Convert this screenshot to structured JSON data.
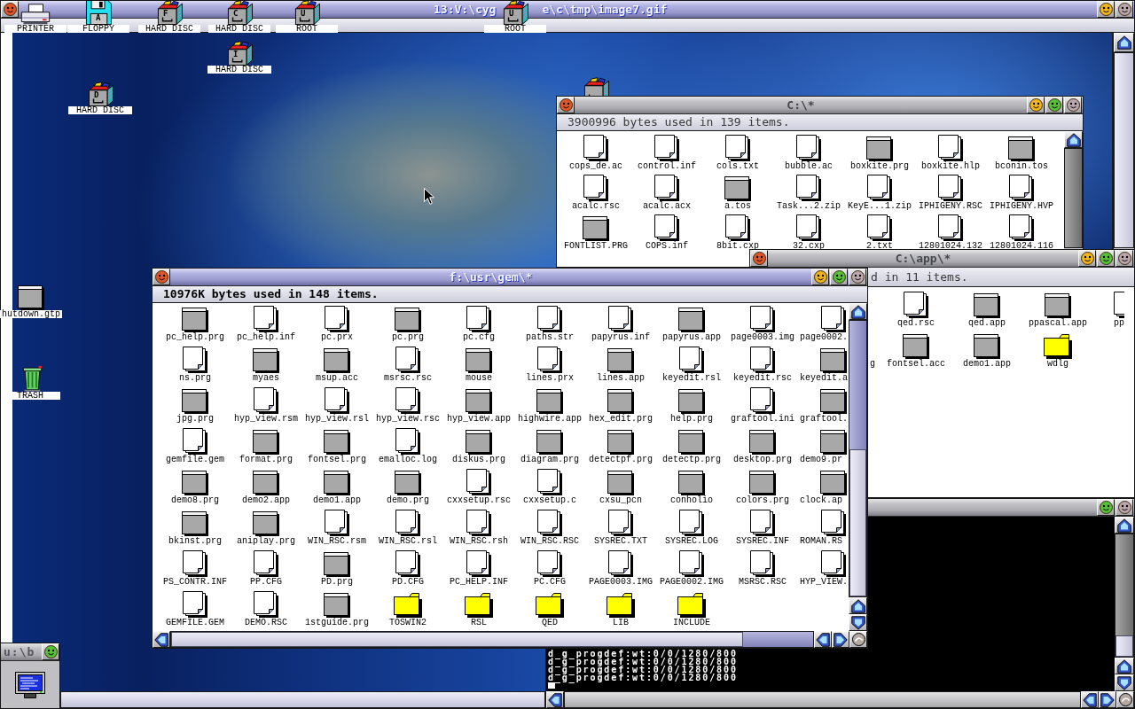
{
  "windows": [
    {
      "kind": "viewer",
      "title_start": "13:V:\\cyg",
      "title_end": "e\\c\\tmp\\image7.gif",
      "focused": true,
      "widgets": [
        {
          "kind": "close"
        },
        {
          "kind": "iconify"
        },
        {
          "kind": "hide"
        }
      ]
    },
    {
      "kind": "folder",
      "title": "C:\\*",
      "info": "3900996 bytes used in 139 items.",
      "focused": false,
      "widgets": [
        {
          "kind": "close"
        },
        {
          "kind": "iconify"
        },
        {
          "kind": "fullsize"
        },
        {
          "kind": "hide"
        }
      ],
      "rows": [
        [
          {
            "kind": "document",
            "label": "cops_de.ac"
          },
          {
            "kind": "document",
            "label": "control.inf"
          },
          {
            "kind": "document",
            "label": "cols.txt"
          },
          {
            "kind": "document",
            "label": "bubble.ac"
          },
          {
            "kind": "program",
            "label": "boxkite.prg"
          },
          {
            "kind": "document",
            "label": "boxkite.hlp"
          },
          {
            "kind": "program",
            "label": "bconin.tos"
          }
        ],
        [
          {
            "kind": "document",
            "label": "acalc.rsc"
          },
          {
            "kind": "document",
            "label": "acalc.acx"
          },
          {
            "kind": "program",
            "label": "a.tos"
          },
          {
            "kind": "document",
            "label": "Task...2.zip"
          },
          {
            "kind": "document",
            "label": "KeyE...1.zip"
          },
          {
            "kind": "document",
            "label": "IPHIGENY.RSC"
          },
          {
            "kind": "document",
            "label": "IPHIGENY.HVP"
          }
        ],
        [
          {
            "kind": "program",
            "label": "FONTLIST.PRG"
          },
          {
            "kind": "document",
            "label": "COPS.inf"
          },
          {
            "kind": "document",
            "label": "8bit.cxp"
          },
          {
            "kind": "document",
            "label": "32.cxp"
          },
          {
            "kind": "document",
            "label": "2.txt"
          },
          {
            "kind": "document",
            "label": "12801024.132"
          },
          {
            "kind": "document",
            "label": "12801024.116"
          }
        ]
      ]
    },
    {
      "kind": "folder",
      "title": "C:\\app\\*",
      "info": "d in 11 items.",
      "focused": false,
      "widgets": [
        {
          "kind": "close"
        },
        {
          "kind": "iconify"
        },
        {
          "kind": "fullsize"
        },
        {
          "kind": "hide"
        }
      ],
      "rows": [
        [
          "",
          {
            "kind": "document",
            "label": "qed.rsc"
          },
          {
            "kind": "program",
            "label": "qed.app"
          },
          {
            "kind": "program",
            "label": "ppascal.app"
          },
          {
            "kind": "document",
            "label": "pp",
            "cut_end": true
          }
        ],
        [
          {
            "label": "g",
            "cut_start": true
          },
          {
            "kind": "program",
            "label": "fontsel.acc"
          },
          {
            "kind": "program",
            "label": "demo1.app"
          },
          {
            "kind": "folder",
            "label": "wdlg"
          }
        ]
      ]
    },
    {
      "kind": "console",
      "focused": false,
      "widgets": [
        {
          "kind": "fullsize"
        },
        {
          "kind": "hide"
        }
      ],
      "lines": [
        "d_g_progdef:wt:0/0/1280/800",
        "d_g_progdef:wt:0/0/1280/800",
        "d_g_progdef:wt:0/0/1280/800",
        "d_g_progdef:wt:0/0/1280/800"
      ],
      "cursor": true
    },
    {
      "kind": "folder",
      "title": "f:\\usr\\gem\\*",
      "info": "10976K bytes used in 148 items.",
      "focused": true,
      "widgets": [
        {
          "kind": "close"
        },
        {
          "kind": "iconify"
        },
        {
          "kind": "fullsize"
        },
        {
          "kind": "hide"
        }
      ],
      "rows": [
        [
          {
            "kind": "program",
            "label": "pc_help.prg"
          },
          {
            "kind": "document",
            "label": "pc_help.inf"
          },
          {
            "kind": "document",
            "label": "pc.prx"
          },
          {
            "kind": "program",
            "label": "pc.prg"
          },
          {
            "kind": "document",
            "label": "pc.cfg"
          },
          {
            "kind": "document",
            "label": "paths.str"
          },
          {
            "kind": "document",
            "label": "papyrus.inf"
          },
          {
            "kind": "program",
            "label": "papyrus.app"
          },
          {
            "kind": "document",
            "label": "page0003.img"
          },
          {
            "kind": "document",
            "label": "page0002.",
            "cut_end": true
          }
        ],
        [
          {
            "kind": "document",
            "label": "ns.prg"
          },
          {
            "kind": "program",
            "label": "myaes"
          },
          {
            "kind": "program",
            "label": "msup.acc"
          },
          {
            "kind": "document",
            "label": "msrsc.rsc"
          },
          {
            "kind": "program",
            "label": "mouse"
          },
          {
            "kind": "document",
            "label": "lines.prx"
          },
          {
            "kind": "program",
            "label": "lines.app"
          },
          {
            "kind": "document",
            "label": "keyedit.rsl"
          },
          {
            "kind": "document",
            "label": "keyedit.rsc"
          },
          {
            "kind": "program",
            "label": "keyedit.a",
            "cut_end": true
          }
        ],
        [
          {
            "kind": "program",
            "label": "jpg.prg"
          },
          {
            "kind": "document",
            "label": "hyp_view.rsm"
          },
          {
            "kind": "document",
            "label": "hyp_view.rsl"
          },
          {
            "kind": "document",
            "label": "hyp_view.rsc"
          },
          {
            "kind": "program",
            "label": "hyp_view.app"
          },
          {
            "kind": "program",
            "label": "highwire.app"
          },
          {
            "kind": "program",
            "label": "hex_edit.prg"
          },
          {
            "kind": "program",
            "label": "help.prg"
          },
          {
            "kind": "document",
            "label": "graftool.ini"
          },
          {
            "kind": "program",
            "label": "graftool.",
            "cut_end": true
          }
        ],
        [
          {
            "kind": "document",
            "label": "gemfile.gem"
          },
          {
            "kind": "program",
            "label": "format.prg"
          },
          {
            "kind": "program",
            "label": "fontsel.prg"
          },
          {
            "kind": "document",
            "label": "emalloc.log"
          },
          {
            "kind": "program",
            "label": "diskus.prg"
          },
          {
            "kind": "program",
            "label": "diagram.prg"
          },
          {
            "kind": "program",
            "label": "detectpf.prg"
          },
          {
            "kind": "program",
            "label": "detectp.prg"
          },
          {
            "kind": "program",
            "label": "desktop.prg"
          },
          {
            "kind": "program",
            "label": "demo9.pr",
            "cut_end": true
          }
        ],
        [
          {
            "kind": "program",
            "label": "demo8.prg"
          },
          {
            "kind": "program",
            "label": "demo2.app"
          },
          {
            "kind": "program",
            "label": "demo1.app"
          },
          {
            "kind": "program",
            "label": "demo.prg"
          },
          {
            "kind": "document",
            "label": "cxxsetup.rsc"
          },
          {
            "kind": "document",
            "label": "cxxsetup.c"
          },
          {
            "kind": "program",
            "label": "cxsu_pcn"
          },
          {
            "kind": "program",
            "label": "conholio"
          },
          {
            "kind": "program",
            "label": "colors.prg"
          },
          {
            "kind": "program",
            "label": "clock.ap",
            "cut_end": true
          }
        ],
        [
          {
            "kind": "program",
            "label": "bkinst.prg"
          },
          {
            "kind": "program",
            "label": "aniplay.prg"
          },
          {
            "kind": "document",
            "label": "WIN_RSC.rsm"
          },
          {
            "kind": "document",
            "label": "WIN_RSC.rsl"
          },
          {
            "kind": "document",
            "label": "WIN_RSC.rsh"
          },
          {
            "kind": "document",
            "label": "WIN_RSC.RSC"
          },
          {
            "kind": "document",
            "label": "SYSREC.TXT"
          },
          {
            "kind": "document",
            "label": "SYSREC.LOG"
          },
          {
            "kind": "document",
            "label": "SYSREC.INF"
          },
          {
            "kind": "document",
            "label": "ROMAN.RS",
            "cut_end": true
          }
        ],
        [
          {
            "kind": "document",
            "label": "PS_CONTR.INF"
          },
          {
            "kind": "document",
            "label": "PP.CFG"
          },
          {
            "kind": "program",
            "label": "PD.prg"
          },
          {
            "kind": "document",
            "label": "PD.CFG"
          },
          {
            "kind": "document",
            "label": "PC_HELP.INF"
          },
          {
            "kind": "document",
            "label": "PC.CFG"
          },
          {
            "kind": "document",
            "label": "PAGE0003.IMG"
          },
          {
            "kind": "document",
            "label": "PAGE0002.IMG"
          },
          {
            "kind": "document",
            "label": "MSRSC.RSC"
          },
          {
            "kind": "document",
            "label": "HYP_VIEW.",
            "cut_end": true
          }
        ],
        [
          {
            "kind": "document",
            "label": "GEMFILE.GEM"
          },
          {
            "kind": "document",
            "label": "DEMO.RSC"
          },
          {
            "kind": "program",
            "label": "1stguide.prg"
          },
          {
            "kind": "folder",
            "label": "TOSWIN2"
          },
          {
            "kind": "folder",
            "label": "RSL"
          },
          {
            "kind": "folder",
            "label": "QED"
          },
          {
            "kind": "folder",
            "label": "LIB"
          },
          {
            "kind": "folder",
            "label": "INCLUDE"
          }
        ]
      ]
    }
  ],
  "desktop_icons": [
    {
      "kind": "printer",
      "label": "PRINTER"
    },
    {
      "kind": "floppy",
      "letter": "A",
      "label": "FLOPPY"
    },
    {
      "kind": "drive",
      "letter": "F",
      "label": "HARD DISC"
    },
    {
      "kind": "drive",
      "letter": "C",
      "label": "HARD DISC"
    },
    {
      "kind": "drive",
      "letter": "U",
      "label": "ROOT"
    },
    {
      "kind": "drive",
      "letter": "U",
      "label": "ROOT"
    },
    {
      "kind": "drive",
      "letter": "I",
      "label": "HARD DISC"
    },
    {
      "kind": "drive",
      "letter": "D",
      "label": "HARD DISC"
    },
    {
      "kind": "drive",
      "partial": true
    },
    {
      "kind": "program",
      "label": "hutdown.gtp"
    },
    {
      "kind": "trash",
      "label": "TRASH"
    }
  ],
  "iconified_windows": [
    {
      "title": "u:\\b",
      "widgets": [
        {
          "kind": "fullsize"
        }
      ]
    }
  ]
}
